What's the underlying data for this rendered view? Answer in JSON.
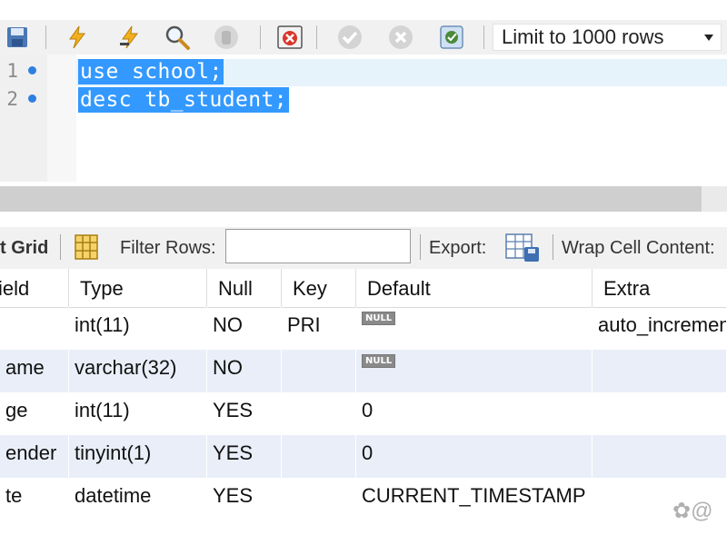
{
  "toolbar": {
    "buttons": [
      {
        "name": "save-icon"
      },
      {
        "name": "execute-icon"
      },
      {
        "name": "execute-current-icon"
      },
      {
        "name": "explain-icon"
      },
      {
        "name": "stop-icon"
      },
      {
        "name": "toggle-error-icon"
      },
      {
        "name": "commit-icon"
      },
      {
        "name": "rollback-icon"
      },
      {
        "name": "autocommit-icon"
      }
    ],
    "limit_label": "Limit to 1000 rows"
  },
  "editor": {
    "lines": [
      {
        "number": "1",
        "code": "use school;"
      },
      {
        "number": "2",
        "code": "desc tb_student;"
      }
    ],
    "selection_color": "#3399ff"
  },
  "result_bar": {
    "grid_label": "t Grid",
    "filter_label": "Filter Rows:",
    "filter_value": "",
    "export_label": "Export:",
    "wrap_label": "Wrap Cell Content:"
  },
  "grid": {
    "columns": [
      "ield",
      "Type",
      "Null",
      "Key",
      "Default",
      "Extra"
    ],
    "rows": [
      {
        "field": "",
        "type": "int(11)",
        "null": "NO",
        "key": "PRI",
        "default": "NULL",
        "default_is_null": true,
        "extra": "auto_incremen"
      },
      {
        "field": "ame",
        "type": "varchar(32)",
        "null": "NO",
        "key": "",
        "default": "NULL",
        "default_is_null": true,
        "extra": ""
      },
      {
        "field": "ge",
        "type": "int(11)",
        "null": "YES",
        "key": "",
        "default": "0",
        "default_is_null": false,
        "extra": ""
      },
      {
        "field": "ender",
        "type": "tinyint(1)",
        "null": "YES",
        "key": "",
        "default": "0",
        "default_is_null": false,
        "extra": ""
      },
      {
        "field": "te",
        "type": "datetime",
        "null": "YES",
        "key": "",
        "default": "CURRENT_TIMESTAMP",
        "default_is_null": false,
        "extra": ""
      }
    ]
  },
  "watermark": "✿@"
}
